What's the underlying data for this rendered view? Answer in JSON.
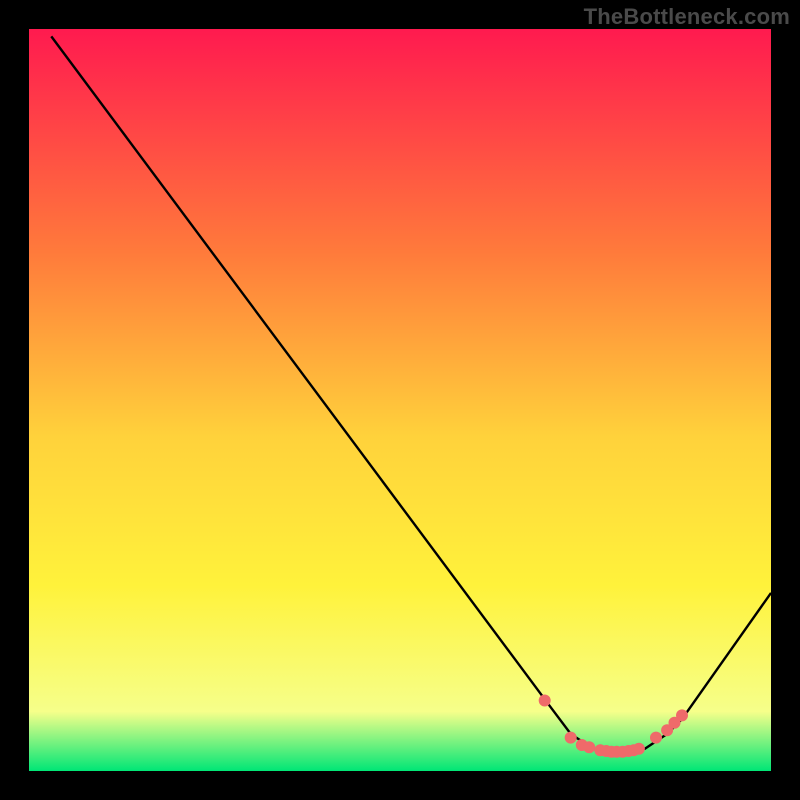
{
  "watermark": "TheBottleneck.com",
  "colors": {
    "gradient_top": "#ff1a4f",
    "gradient_mid1": "#ff7a3b",
    "gradient_mid2": "#ffd23b",
    "gradient_mid3": "#fff23b",
    "gradient_low": "#f6ff8a",
    "gradient_bottom": "#00e676",
    "curve": "#000000",
    "marker": "#ef6a6a",
    "frame": "#000000"
  },
  "chart_data": {
    "type": "line",
    "title": "",
    "xlabel": "",
    "ylabel": "",
    "xlim": [
      0,
      100
    ],
    "ylim": [
      0,
      100
    ],
    "series": [
      {
        "name": "curve",
        "x": [
          3,
          70,
          73,
          76,
          80,
          83,
          86,
          88,
          100
        ],
        "y": [
          99,
          9,
          5,
          3,
          2.5,
          3,
          5,
          7,
          24
        ]
      }
    ],
    "markers": {
      "name": "points",
      "x": [
        69.5,
        73,
        74.5,
        75.5,
        77,
        77.8,
        78.5,
        79.2,
        80,
        80.8,
        81.5,
        82.2,
        84.5,
        86,
        87,
        88
      ],
      "y": [
        9.5,
        4.5,
        3.5,
        3.2,
        2.8,
        2.7,
        2.6,
        2.6,
        2.6,
        2.7,
        2.8,
        3,
        4.5,
        5.5,
        6.5,
        7.5
      ]
    }
  }
}
